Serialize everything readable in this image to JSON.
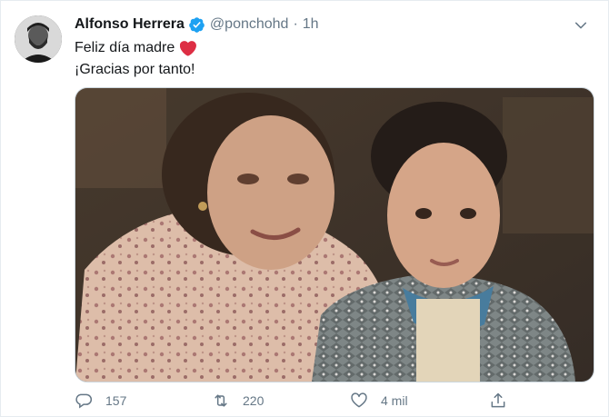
{
  "tweet": {
    "author_name": "Alfonso Herrera",
    "handle": "@ponchohd",
    "separator": "·",
    "time": "1h",
    "text_line1": "Feliz día madre",
    "text_line2": "¡Gracias por tanto!"
  },
  "actions": {
    "replies": "157",
    "retweets": "220",
    "likes": "4 mil"
  },
  "icons": {
    "verified": "verified-badge-icon",
    "heart_emoji": "red-heart-emoji",
    "more": "chevron-down-icon",
    "reply": "reply-icon",
    "retweet": "retweet-icon",
    "like": "like-icon",
    "share": "share-icon"
  },
  "colors": {
    "verified_blue": "#1da1f2",
    "heart_red": "#dd2e44",
    "muted_text": "#657786",
    "primary_text": "#14171a",
    "border": "#e6ecf0"
  }
}
